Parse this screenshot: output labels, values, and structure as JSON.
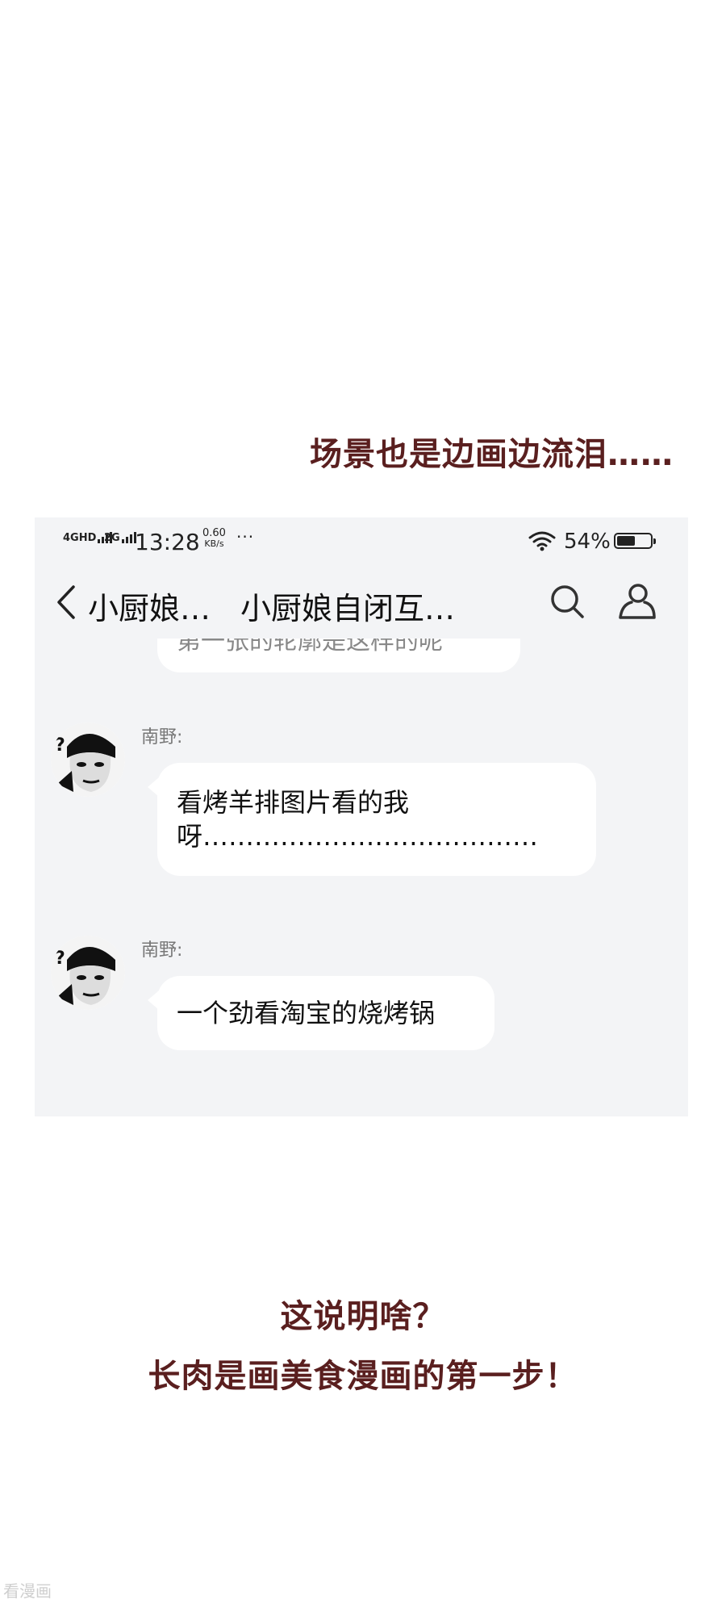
{
  "captions": {
    "top": "场景也是边画边流泪……",
    "bottom_line1": "这说明啥？",
    "bottom_line2": "长肉是画美食漫画的第一步！"
  },
  "status_bar": {
    "network1": "4GHD",
    "network2": "2G",
    "time": "13:28",
    "speed_value": "0.60",
    "speed_unit": "KB/s",
    "more": "···",
    "battery_percent": "54%",
    "battery_level": 0.54
  },
  "nav": {
    "back_label": "小厨娘…",
    "title": "小厨娘自闭互…"
  },
  "messages": [
    {
      "sender": "南野:",
      "text": "看烤羊排图片看的我呀…………………………………"
    },
    {
      "sender": "南野:",
      "text": "一个劲看淘宝的烧烤锅"
    }
  ],
  "partial_message": "第一张的轮廓是这样的呢",
  "watermark": "看漫画"
}
